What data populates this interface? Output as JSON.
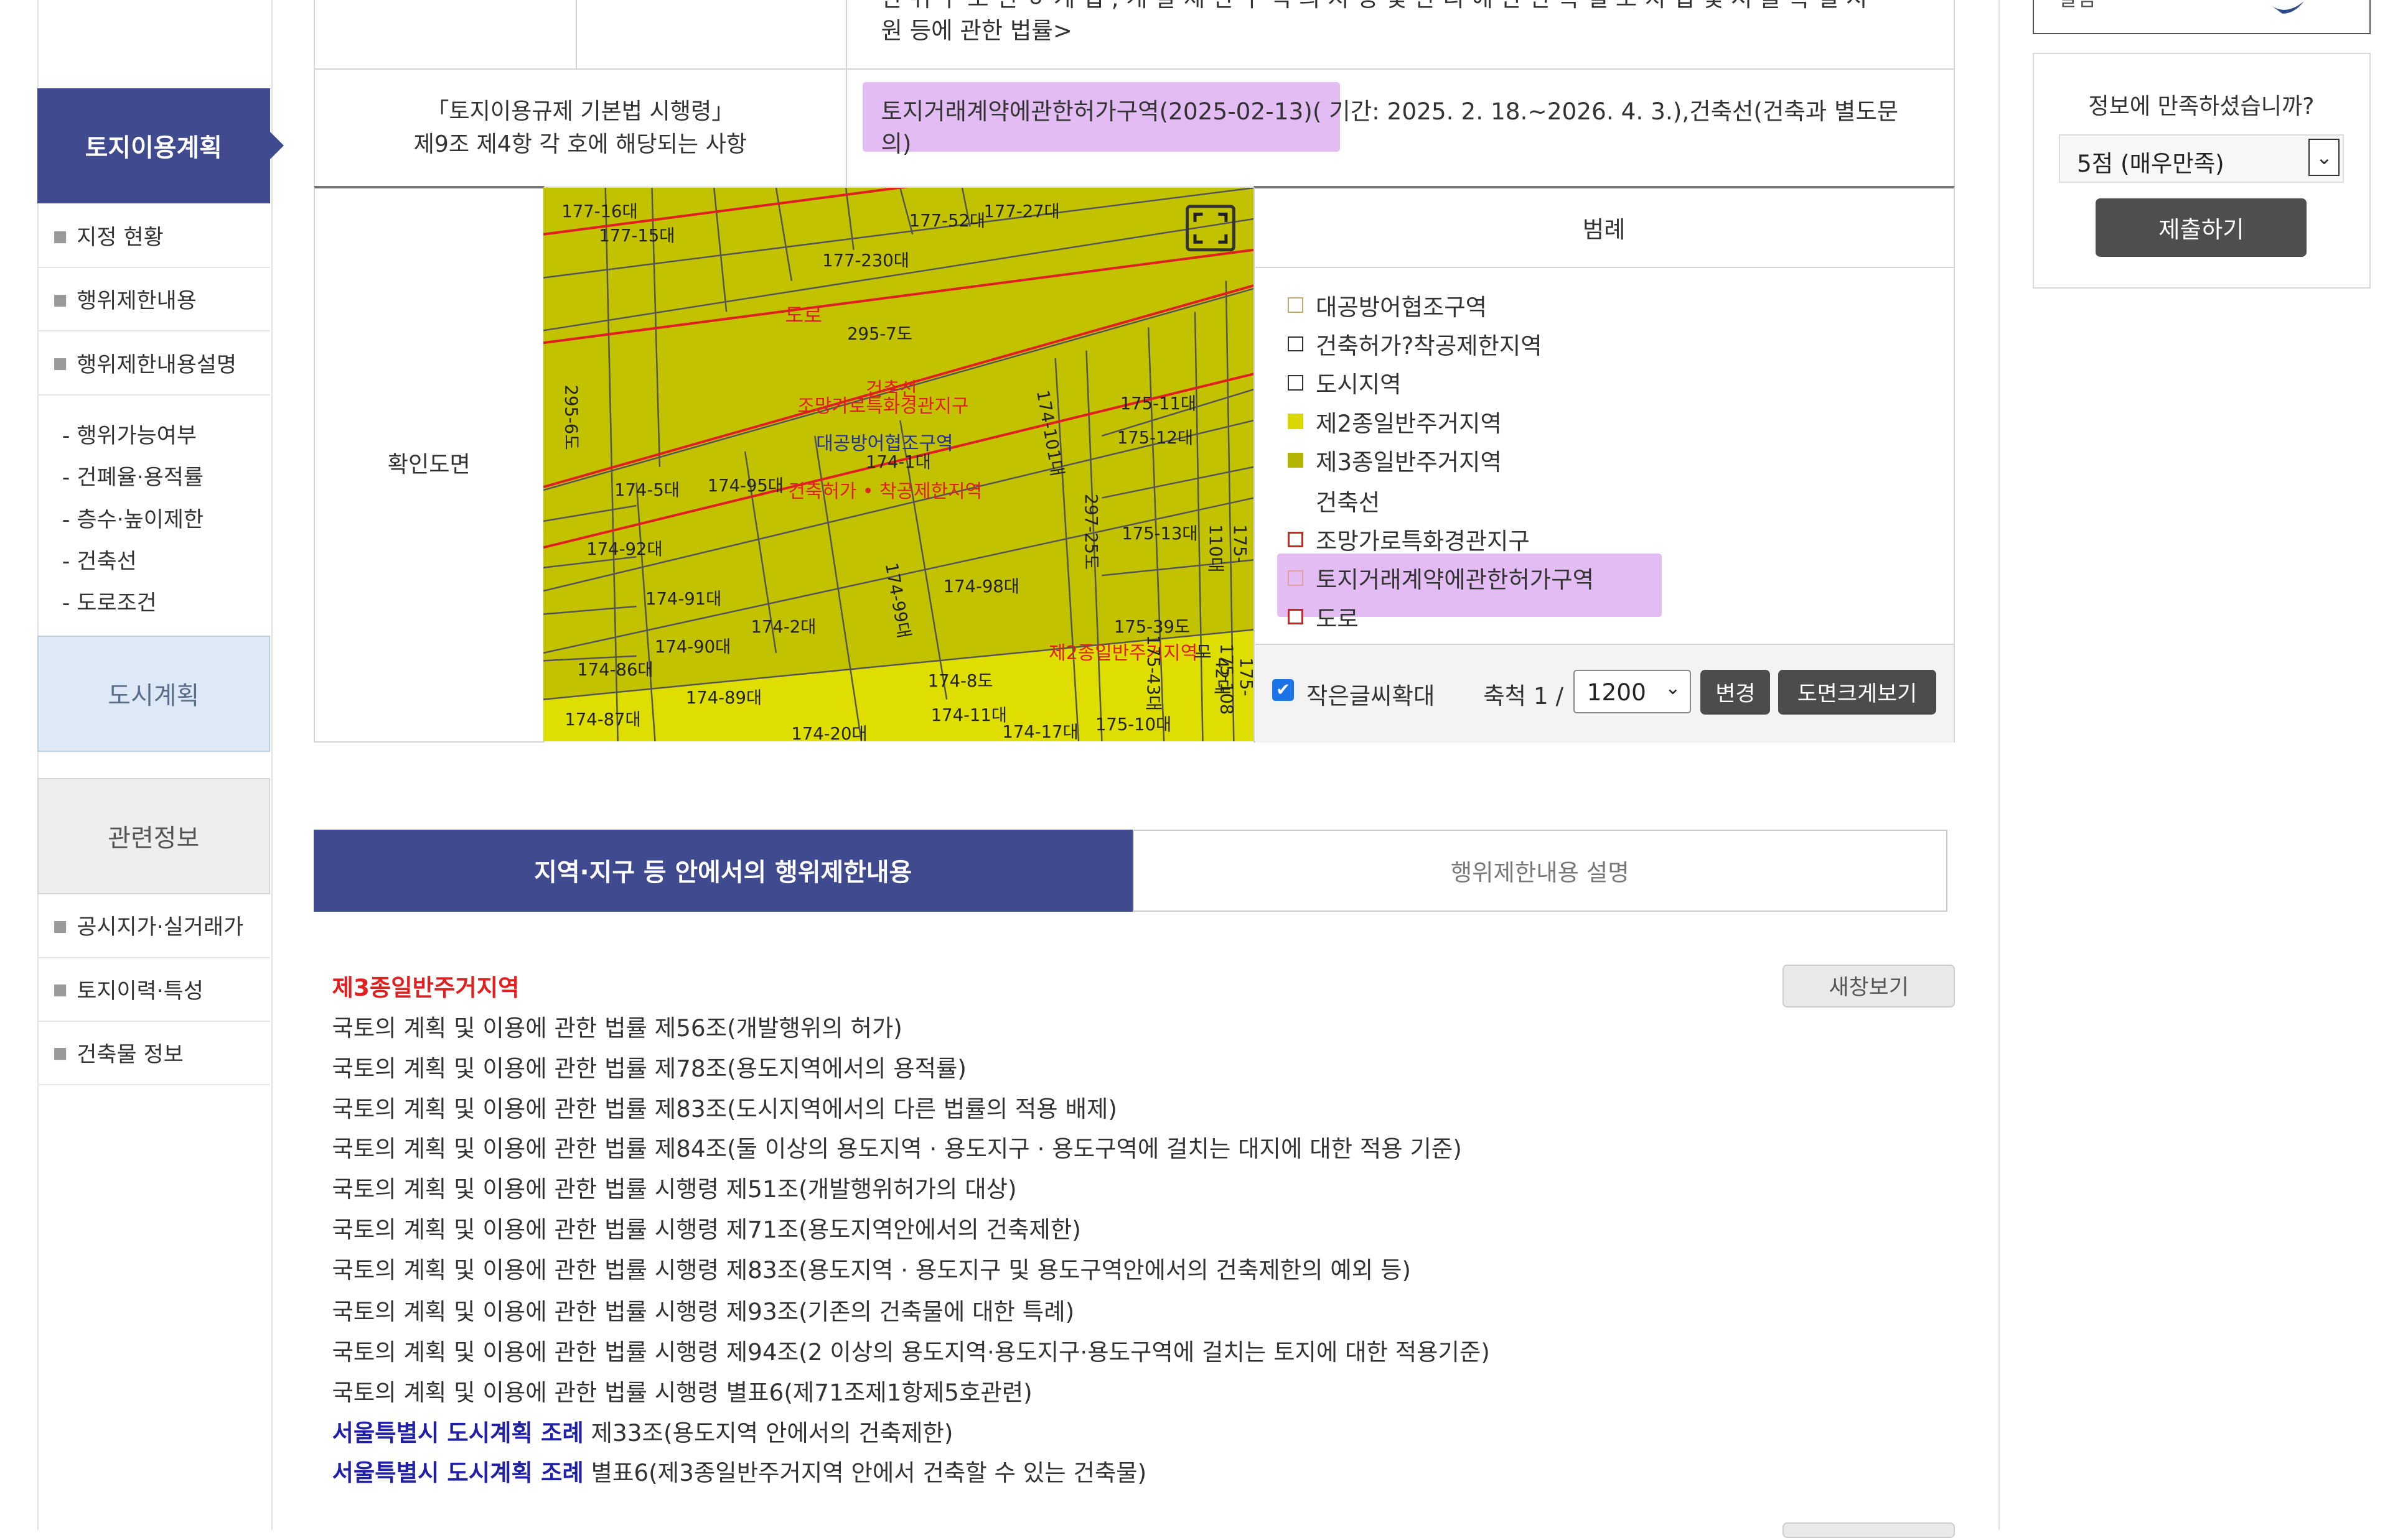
{
  "sidebar": {
    "active": "토지이용계획",
    "items_top": [
      "지정 현황",
      "행위제한내용",
      "행위제한내용설명"
    ],
    "sub_items": [
      "- 행위가능여부",
      "- 건폐율·용적률",
      "- 층수·높이제한",
      "- 건축선",
      "- 도로조건"
    ],
    "box_city": "도시계획",
    "box_related": "관련정보",
    "items_bottom": [
      "공시지가·실거래가",
      "토지이력·특성",
      "건축물 정보"
    ]
  },
  "table": {
    "top_partial_text_1": "원 등에 관한 법률>",
    "top_partial_text_0": "간 위 구 조 전 ㅎ 계 법 , 개 발 제 한 구 역 의 지 정 및 관 리 에 관 한 특 별 조 치 법 및 서 울 특 별 시",
    "row2_label_1": "「토지이용규제 기본법 시행령」",
    "row2_label_2": "제9조 제4항 각 호에 해당되는 사항",
    "row2_value_hl": "토지거래계약에관한허가구역(2025-02-13)",
    "row2_value_rest": "( 기간: 2025. 2. 18.~2026. 4. 3.),건축선(건축과 별도문",
    "row2_value_line2": "의)",
    "row3_label": "확인도면"
  },
  "map": {
    "labels": {
      "road": "도로",
      "lot_295": "295-7도",
      "building_line": "건축선",
      "scenic": "조망가로특화경관지구",
      "defense": "대공방어협조구역",
      "lot_174_1": "174-1대",
      "restrict": "건축허가 • 착공제한지역",
      "lot_174_5": "174-5대",
      "lot_174_95": "174-95대",
      "lot_174_92": "174-92대",
      "lot_174_2": "174-2대",
      "lot_174_99": "174-99대",
      "lot_174_98": "174-98대",
      "lot_175_13": "175-13대",
      "lot_297": "297-25도",
      "lot_174_101": "174-101대",
      "zone2": "제2종일반주거지역",
      "lot_175_12": "175-12대",
      "lot_175_11": "175-11대",
      "lot_174_91": "174-91대",
      "lot_174_90": "174-90대",
      "lot_174_89": "174-89대",
      "lot_174_86": "174-86대",
      "lot_174_87": "174-87대",
      "lot_174_8": "174-8도",
      "lot_174_11": "174-11대",
      "lot_174_17": "174-17대",
      "lot_175_39": "175-39도",
      "lot_175_43": "175-43대",
      "lot_175_10": "175-10대",
      "lot_175_108": "175-108대",
      "lot_175_42": "175-42대",
      "lot_174_20": "174-20대",
      "lot_177_15": "177-15대",
      "lot_177_16": "177-16대",
      "lot_177_52": "177-52대",
      "lot_177_27": "177-27대",
      "lot_177_230": "177-230대",
      "lot_295_6": "295-6도",
      "lot_175_110": "175-110대"
    },
    "colors": {
      "zone3": "#c8c800",
      "zone2": "#e0e000",
      "line_red": "#e02020"
    }
  },
  "legend": {
    "title": "범례",
    "items": [
      {
        "label": "대공방어협조구역",
        "swatch": "#ffffff",
        "border": "#c9a86a"
      },
      {
        "label": "건축허가?착공제한지역",
        "swatch": "#ffffff",
        "border": "#333333"
      },
      {
        "label": "도시지역",
        "swatch": "#ffffff",
        "border": "#333333"
      },
      {
        "label": "제2종일반주거지역",
        "swatch": "#d8d800",
        "border": "#d8d800"
      },
      {
        "label": "제3종일반주거지역",
        "swatch": "#b5b500",
        "border": "#b5b500"
      },
      {
        "label": "건축선",
        "swatch": "",
        "border": ""
      },
      {
        "label": "조망가로특화경관지구",
        "swatch": "#ffffff",
        "border": "#d02020"
      },
      {
        "label": "토지거래계약에관한허가구역",
        "swatch": "#ffffff",
        "border": "#e0a0a0"
      },
      {
        "label": "도로",
        "swatch": "#ffffff",
        "border": "#d02020"
      }
    ],
    "small_text_label": "작은글씨확대",
    "scale_label": "축척 1 /",
    "scale_value": "1200",
    "change_btn": "변경",
    "big_map_btn": "도면크게보기"
  },
  "tabs": {
    "active": "지역·지구 등 안에서의 행위제한내용",
    "inactive": "행위제한내용 설명"
  },
  "laws": {
    "zone_title": "제3종일반주거지역",
    "new_window": "새창보기",
    "lines": [
      {
        "prefix": "",
        "text": "국토의 계획 및 이용에 관한 법률 제56조(개발행위의 허가)"
      },
      {
        "prefix": "",
        "text": "국토의 계획 및 이용에 관한 법률 제78조(용도지역에서의 용적률)"
      },
      {
        "prefix": "",
        "text": "국토의 계획 및 이용에 관한 법률 제83조(도시지역에서의 다른 법률의 적용 배제)"
      },
      {
        "prefix": "",
        "text": "국토의 계획 및 이용에 관한 법률 제84조(둘 이상의 용도지역 · 용도지구 · 용도구역에 걸치는 대지에 대한 적용 기준)"
      },
      {
        "prefix": "",
        "text": "국토의 계획 및 이용에 관한 법률 시행령 제51조(개발행위허가의 대상)"
      },
      {
        "prefix": "",
        "text": "국토의 계획 및 이용에 관한 법률 시행령 제71조(용도지역안에서의 건축제한)"
      },
      {
        "prefix": "",
        "text": "국토의 계획 및 이용에 관한 법률 시행령 제83조(용도지역 · 용도지구 및 용도구역안에서의 건축제한의 예외 등)"
      },
      {
        "prefix": "",
        "text": "국토의 계획 및 이용에 관한 법률 시행령 제93조(기존의 건축물에 대한 특례)"
      },
      {
        "prefix": "",
        "text": "국토의 계획 및 이용에 관한 법률 시행령 제94조(2 이상의 용도지역·용도지구·용도구역에 걸치는 토지에 대한 적용기준)"
      },
      {
        "prefix": "",
        "text": "국토의 계획 및 이용에 관한 법률 시행령 별표6(제71조제1항제5호관련)"
      },
      {
        "prefix": "서울특별시 도시계획 조례",
        "text": " 제33조(용도지역 안에서의 건축제한)"
      },
      {
        "prefix": "서울특별시 도시계획 조례",
        "text": " 별표6(제3종일반주거지역 안에서 건축할 수 있는 건축물)"
      }
    ]
  },
  "right_panel": {
    "top_partial": "알림",
    "survey_question": "정보에 만족하셨습니까?",
    "survey_selected": "5점 (매우만족)",
    "submit": "제출하기"
  }
}
